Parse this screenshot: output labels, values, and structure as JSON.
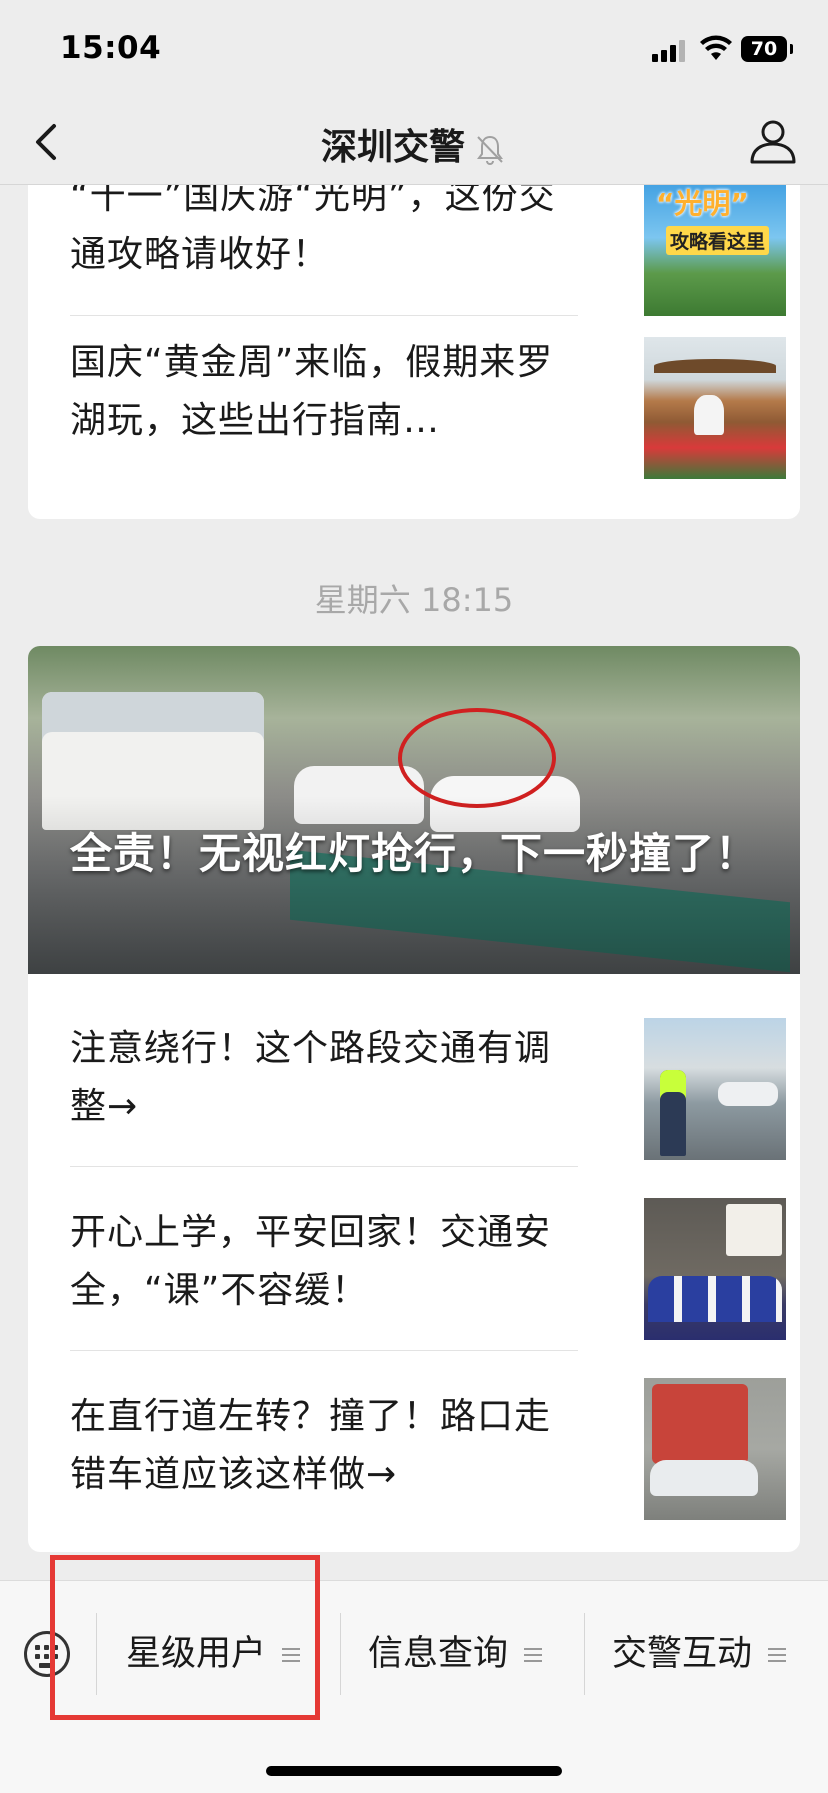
{
  "status_bar": {
    "time": "15:04",
    "battery": "70"
  },
  "nav": {
    "title": "深圳交警"
  },
  "group1": {
    "articles": [
      {
        "title": "“十一”国庆游“光明”，这份交通攻略请收好！",
        "thumb_text": "“光明”",
        "thumb_sub": "攻略看这里"
      },
      {
        "title": "国庆“黄金周”来临，假期来罗湖玩，这些出行指南…"
      }
    ]
  },
  "group2": {
    "date": "星期六 18:15",
    "hero_title": "全责！无视红灯抢行，下一秒撞了！",
    "articles": [
      {
        "title": "注意绕行！这个路段交通有调整→"
      },
      {
        "title": "开心上学，平安回家！交通安全，“课”不容缓！"
      },
      {
        "title": "在直行道左转？撞了！路口走错车道应该这样做→"
      }
    ]
  },
  "menu": {
    "items": [
      {
        "label": "星级用户"
      },
      {
        "label": "信息查询"
      },
      {
        "label": "交警互动"
      }
    ]
  },
  "colors": {
    "background": "#ededed",
    "highlight": "#e53935",
    "menu_bg": "#f7f7f7"
  }
}
